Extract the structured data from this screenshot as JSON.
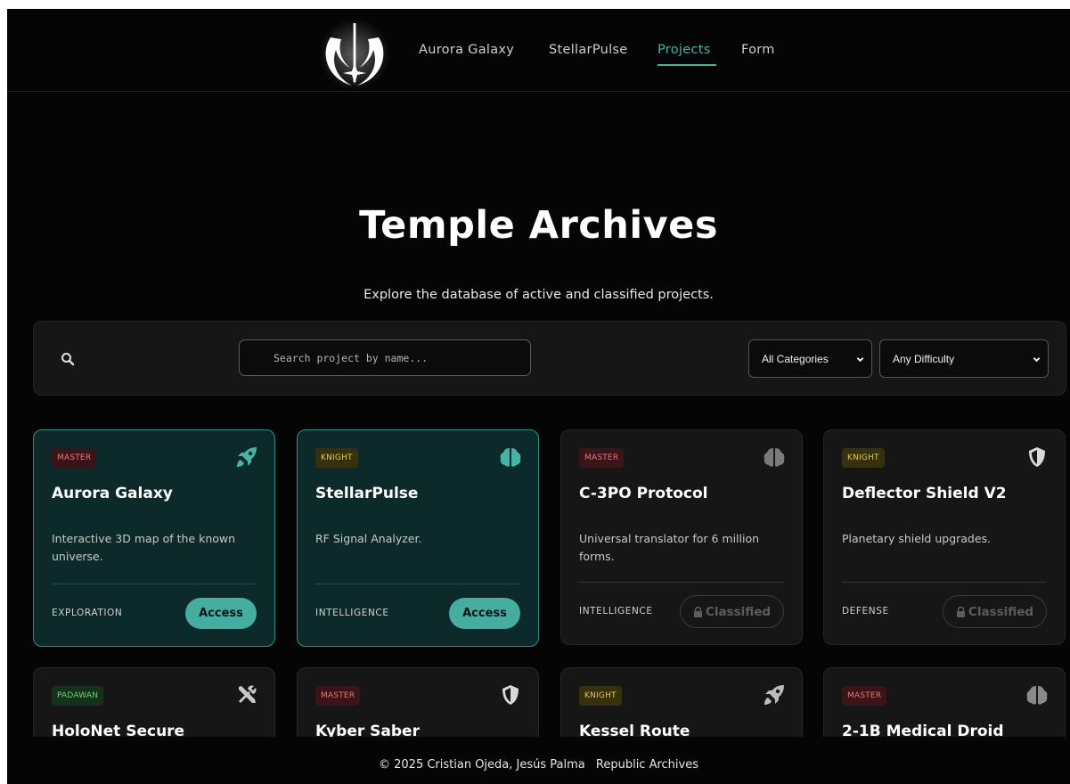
{
  "nav": {
    "links": [
      "Aurora Galaxy",
      "StellarPulse",
      "Projects",
      "Form"
    ],
    "active": "Projects"
  },
  "hero": {
    "title": "Temple Archives",
    "subtitle": "Explore the database of active and classified projects."
  },
  "filters": {
    "search_placeholder": "Search project by name...",
    "category": "All Categories",
    "difficulty": "Any Difficulty"
  },
  "cards": [
    {
      "rank": "MASTER",
      "icon": "rocket-icon",
      "title": "Aurora Galaxy",
      "description": "Interactive 3D map of the known universe.",
      "category": "EXPLORATION",
      "action": "Access"
    },
    {
      "rank": "KNIGHT",
      "icon": "brain-icon",
      "title": "StellarPulse",
      "description": "RF Signal Analyzer.",
      "category": "INTELLIGENCE",
      "action": "Access"
    },
    {
      "rank": "MASTER",
      "icon": "brain-icon",
      "title": "C-3PO Protocol",
      "description": "Universal translator for 6 million forms.",
      "category": "INTELLIGENCE",
      "action": "Classified"
    },
    {
      "rank": "KNIGHT",
      "icon": "shield-icon",
      "title": "Deflector Shield V2",
      "description": "Planetary shield upgrades.",
      "category": "DEFENSE",
      "action": "Classified"
    },
    {
      "rank": "PADAWAN",
      "icon": "tools-icon",
      "title": "HoloNet Secure"
    },
    {
      "rank": "MASTER",
      "icon": "shield-icon",
      "title": "Kyber Saber"
    },
    {
      "rank": "KNIGHT",
      "icon": "rocket-icon",
      "title": "Kessel Route"
    },
    {
      "rank": "MASTER",
      "icon": "brain-icon",
      "title": "2-1B Medical Droid"
    }
  ],
  "footer": {
    "credits": "© 2025 Cristian Ojeda, Jesús Palma",
    "org": "Republic Archives"
  },
  "colors": {
    "accent": "#45aea0",
    "background": "#050505",
    "card": "#161616",
    "card_open": "#0c2a2a"
  }
}
